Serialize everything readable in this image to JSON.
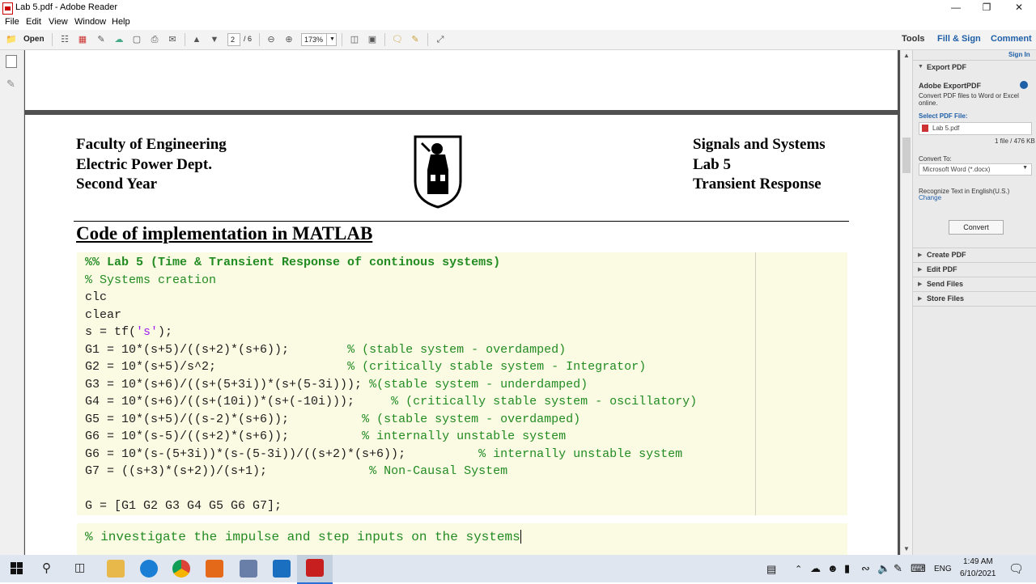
{
  "window": {
    "title": "Lab 5.pdf - Adobe Reader",
    "minimize": "—",
    "maximize": "❐",
    "close": "✕"
  },
  "menu": [
    "File",
    "Edit",
    "View",
    "Window",
    "Help"
  ],
  "toolbar": {
    "open_label": "Open",
    "page_current": "2",
    "page_total": "/ 6",
    "zoom": "173%",
    "tools_label": "Tools",
    "fill_sign_label": "Fill & Sign",
    "comment_label": "Comment",
    "accent": "#1f5fa8"
  },
  "document": {
    "header_left": [
      "Faculty of Engineering",
      "Electric Power Dept.",
      "Second Year"
    ],
    "header_right": [
      "Signals and Systems",
      "Lab 5",
      "Transient Response"
    ],
    "section_title": "Code of implementation in MATLAB",
    "code_lines": [
      {
        "parts": [
          {
            "t": "%% Lab 5 (Time & Transient Response of continous systems)",
            "c": "cm-bold"
          }
        ]
      },
      {
        "parts": [
          {
            "t": "% Systems creation",
            "c": "cm"
          }
        ]
      },
      {
        "parts": [
          {
            "t": "clc",
            "c": ""
          }
        ]
      },
      {
        "parts": [
          {
            "t": "clear",
            "c": ""
          }
        ]
      },
      {
        "parts": [
          {
            "t": "s = tf(",
            "c": ""
          },
          {
            "t": "'s'",
            "c": "str"
          },
          {
            "t": ");",
            "c": ""
          }
        ]
      },
      {
        "parts": [
          {
            "t": "G1 = 10*(s+5)/((s+2)*(s+6));        ",
            "c": ""
          },
          {
            "t": "% (stable system - overdamped)",
            "c": "cm"
          }
        ]
      },
      {
        "parts": [
          {
            "t": "G2 = 10*(s+5)/s^2;                  ",
            "c": ""
          },
          {
            "t": "% (critically stable system - Integrator)",
            "c": "cm"
          }
        ]
      },
      {
        "parts": [
          {
            "t": "G3 = 10*(s+6)/((s+(5+3i))*(s+(5-3i))); ",
            "c": ""
          },
          {
            "t": "%(stable system - underdamped)",
            "c": "cm"
          }
        ]
      },
      {
        "parts": [
          {
            "t": "G4 = 10*(s+6)/((s+(10i))*(s+(-10i)));     ",
            "c": ""
          },
          {
            "t": "% (critically stable system - oscillatory)",
            "c": "cm"
          }
        ]
      },
      {
        "parts": [
          {
            "t": "G5 = 10*(s+5)/((s-2)*(s+6));          ",
            "c": ""
          },
          {
            "t": "% (stable system - overdamped)",
            "c": "cm"
          }
        ]
      },
      {
        "parts": [
          {
            "t": "G6 = 10*(s-5)/((s+2)*(s+6));          ",
            "c": ""
          },
          {
            "t": "% internally unstable system",
            "c": "cm"
          }
        ]
      },
      {
        "parts": [
          {
            "t": "G6 = 10*(s-(5+3i))*(s-(5-3i))/((s+2)*(s+6));          ",
            "c": ""
          },
          {
            "t": "% internally unstable system",
            "c": "cm"
          }
        ]
      },
      {
        "parts": [
          {
            "t": "G7 = ((s+3)*(s+2))/(s+1);              ",
            "c": ""
          },
          {
            "t": "% Non-Causal System",
            "c": "cm"
          }
        ]
      },
      {
        "parts": [
          {
            "t": "",
            "c": ""
          }
        ]
      },
      {
        "parts": [
          {
            "t": "G = [G1 G2 G3 G4 G5 G6 G7];",
            "c": ""
          }
        ]
      }
    ],
    "code_comment_2": "% investigate the impulse and step inputs on the systems"
  },
  "right_panel": {
    "sign_in": "Sign In",
    "export_pdf": "Export PDF",
    "adobe_exportpdf": "Adobe ExportPDF",
    "convert_desc": "Convert PDF files to Word or Excel online.",
    "select_pdf_label": "Select PDF File:",
    "selected_file": "Lab 5.pdf",
    "file_size": "1 file / 476 KB",
    "convert_to_label": "Convert To:",
    "convert_to_value": "Microsoft Word (*.docx)",
    "recognize_text": "Recognize Text in English(U.S.)",
    "change_link": "Change",
    "convert_button": "Convert",
    "sections": [
      "Create PDF",
      "Edit PDF",
      "Send Files",
      "Store Files"
    ]
  },
  "taskbar": {
    "language": "ENG",
    "time": "1:49 AM",
    "date": "6/10/2021"
  }
}
